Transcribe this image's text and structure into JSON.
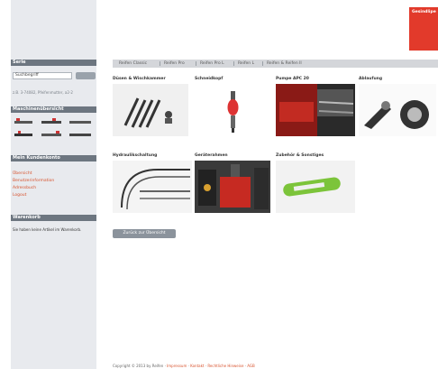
{
  "brand": {
    "logo_text": "Gesindlipe"
  },
  "sidebar": {
    "search_heading": "Serie",
    "search_value": "Suchbegriff",
    "search_note": "z.B. 3-74082, Pfeifenmutter, a2-2",
    "machine_heading": "Maschinenübersicht",
    "account_heading": "Mein Kundenkonto",
    "account_links": [
      "Übersicht",
      "Benutzerinformation",
      "Adressbuch",
      "Logout"
    ],
    "cart_heading": "Warenkorb",
    "cart_text": "Sie haben keine Artikel im Warenkorb."
  },
  "tabs": [
    "Reifen Classic",
    "Reifen Pro",
    "Reifen Pro L",
    "Reifen L",
    "Reifen & Reifen II"
  ],
  "categories": [
    {
      "title": "Düsen & Wischkammer",
      "image": "nozzles-image"
    },
    {
      "title": "Schneidkopf",
      "image": "cutting-head-image"
    },
    {
      "title": "Pumpe APC 20",
      "image": "pump-image"
    },
    {
      "title": "Ablaufung",
      "image": "drain-image"
    },
    {
      "title": "Hydraulikschaltung",
      "image": "hydraulic-image"
    },
    {
      "title": "Geräterahmen",
      "image": "frame-image"
    },
    {
      "title": "Zubehör & Sonstiges",
      "image": "accessories-image"
    }
  ],
  "back_button": "Zurück zur Übersicht",
  "footer": {
    "copyright": "Copyright © 2013 by Reifen · ",
    "links": [
      "Impressum",
      "Kontakt",
      "Rechtliche Hinweise",
      "AGB"
    ]
  },
  "colors": {
    "accent": "#e23a2b",
    "link": "#d8532e",
    "sidebar_head": "#6d7680"
  }
}
